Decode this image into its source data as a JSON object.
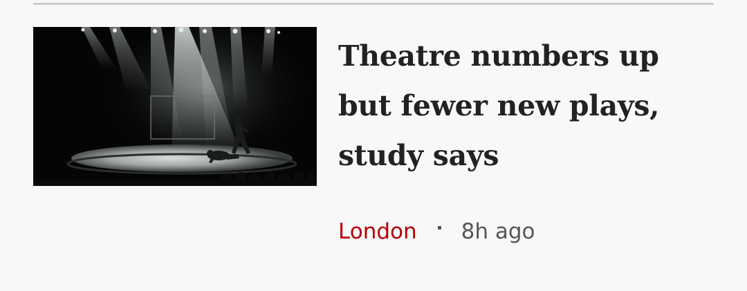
{
  "story": {
    "headline": "Theatre numbers up but fewer new plays, study says",
    "location": "London",
    "timestamp": "8h ago",
    "image_subject": "stage-performance-spotlight"
  },
  "colors": {
    "background": "#f8f8f8",
    "headline": "#202224",
    "location": "#b80000",
    "timestamp": "#545658",
    "divider": "#cccccc"
  }
}
